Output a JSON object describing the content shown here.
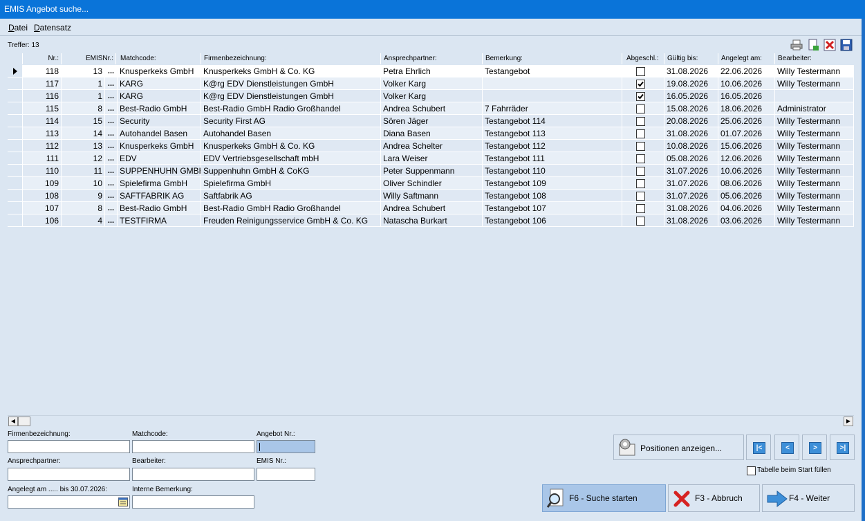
{
  "window": {
    "title": "EMIS Angebot suche..."
  },
  "menu": {
    "items": [
      "Datei",
      "Datensatz"
    ]
  },
  "hits_label": "Treffer: 13",
  "toolbar_icons": [
    "printer-icon",
    "export-icon",
    "delete-icon",
    "save-icon"
  ],
  "columns": {
    "nr": "Nr.:",
    "emisnr": "EMISNr.:",
    "matchcode": "Matchcode:",
    "firma": "Firmenbezeichnung:",
    "ansprech": "Ansprechpartner:",
    "bemerkung": "Bemerkung:",
    "abgeschl": "Abgeschl.:",
    "gueltig": "Gültig bis:",
    "angelegt": "Angelegt am:",
    "bearbeiter": "Bearbeiter:"
  },
  "rows": [
    {
      "nr": "118",
      "emis": "13",
      "dots": "...",
      "match": "Knusperkeks GmbH",
      "firma": "Knusperkeks GmbH & Co. KG",
      "ansprech": "Petra Ehrlich",
      "bem": "Testangebot",
      "checked": false,
      "gueltig": "31.08.2026",
      "angelegt": "22.06.2026",
      "bearb": "Willy Testermann"
    },
    {
      "nr": "117",
      "emis": "1",
      "dots": "...",
      "match": "KARG",
      "firma": "K@rg EDV Dienstleistungen GmbH",
      "ansprech": "Volker Karg",
      "bem": "",
      "checked": true,
      "gueltig": "19.08.2026",
      "angelegt": "10.06.2026",
      "bearb": "Willy Testermann"
    },
    {
      "nr": "116",
      "emis": "1",
      "dots": "...",
      "match": "KARG",
      "firma": "K@rg EDV Dienstleistungen GmbH",
      "ansprech": "Volker Karg",
      "bem": "",
      "checked": true,
      "gueltig": "16.05.2026",
      "angelegt": "16.05.2026",
      "bearb": ""
    },
    {
      "nr": "115",
      "emis": "8",
      "dots": "...",
      "match": "Best-Radio GmbH",
      "firma": "Best-Radio GmbH Radio Großhandel",
      "ansprech": "Andrea Schubert",
      "bem": "7 Fahrräder",
      "checked": false,
      "gueltig": "15.08.2026",
      "angelegt": "18.06.2026",
      "bearb": "Administrator"
    },
    {
      "nr": "114",
      "emis": "15",
      "dots": "...",
      "match": "Security",
      "firma": "Security First AG",
      "ansprech": "Sören Jäger",
      "bem": "Testangebot 114",
      "checked": false,
      "gueltig": "20.08.2026",
      "angelegt": "25.06.2026",
      "bearb": "Willy Testermann"
    },
    {
      "nr": "113",
      "emis": "14",
      "dots": "...",
      "match": "Autohandel Basen",
      "firma": "Autohandel Basen",
      "ansprech": "Diana Basen",
      "bem": "Testangebot 113",
      "checked": false,
      "gueltig": "31.08.2026",
      "angelegt": "01.07.2026",
      "bearb": "Willy Testermann"
    },
    {
      "nr": "112",
      "emis": "13",
      "dots": "...",
      "match": "Knusperkeks GmbH",
      "firma": "Knusperkeks GmbH & Co. KG",
      "ansprech": "Andrea Schelter",
      "bem": "Testangebot 112",
      "checked": false,
      "gueltig": "10.08.2026",
      "angelegt": "15.06.2026",
      "bearb": "Willy Testermann"
    },
    {
      "nr": "111",
      "emis": "12",
      "dots": "...",
      "match": "EDV",
      "firma": "EDV Vertriebsgesellschaft mbH",
      "ansprech": "Lara Weiser",
      "bem": "Testangebot 111",
      "checked": false,
      "gueltig": "05.08.2026",
      "angelegt": "12.06.2026",
      "bearb": "Willy Testermann"
    },
    {
      "nr": "110",
      "emis": "11",
      "dots": "...",
      "match": "SUPPENHUHN GMBH",
      "firma": "Suppenhuhn GmbH & CoKG",
      "ansprech": "Peter Suppenmann",
      "bem": "Testangebot 110",
      "checked": false,
      "gueltig": "31.07.2026",
      "angelegt": "10.06.2026",
      "bearb": "Willy Testermann"
    },
    {
      "nr": "109",
      "emis": "10",
      "dots": "...",
      "match": "Spielefirma GmbH",
      "firma": "Spielefirma GmbH",
      "ansprech": "Oliver Schindler",
      "bem": "Testangebot 109",
      "checked": false,
      "gueltig": "31.07.2026",
      "angelegt": "08.06.2026",
      "bearb": "Willy Testermann"
    },
    {
      "nr": "108",
      "emis": "9",
      "dots": "...",
      "match": "SAFTFABRIK AG",
      "firma": "Saftfabrik AG",
      "ansprech": "Willy Saftmann",
      "bem": "Testangebot 108",
      "checked": false,
      "gueltig": "31.07.2026",
      "angelegt": "05.06.2026",
      "bearb": "Willy Testermann"
    },
    {
      "nr": "107",
      "emis": "8",
      "dots": "...",
      "match": "Best-Radio GmbH",
      "firma": "Best-Radio GmbH Radio Großhandel",
      "ansprech": "Andrea Schubert",
      "bem": "Testangebot 107",
      "checked": false,
      "gueltig": "31.08.2026",
      "angelegt": "04.06.2026",
      "bearb": "Willy Testermann"
    },
    {
      "nr": "106",
      "emis": "4",
      "dots": "...",
      "match": "TESTFIRMA",
      "firma": "Freuden Reinigungsservice GmbH & Co. KG",
      "ansprech": "Natascha Burkart",
      "bem": "Testangebot 106",
      "checked": false,
      "gueltig": "31.08.2026",
      "angelegt": "03.06.2026",
      "bearb": "Willy Testermann"
    }
  ],
  "filters": {
    "firma_label": "Firmenbezeichnung:",
    "match_label": "Matchcode:",
    "angebot_label": "Angebot Nr.:",
    "ansprech_label": "Ansprechpartner:",
    "bearb_label": "Bearbeiter:",
    "emis_label": "EMIS Nr.:",
    "angelegt_label": "Angelegt am ..... bis 30.07.2026:",
    "bemerkung_label": "Interne Bemerkung:"
  },
  "buttons": {
    "positionen": "Positionen anzeigen...",
    "tabelle_fuellen": "Tabelle beim Start füllen",
    "suche": "F6 - Suche starten",
    "abbruch": "F3 - Abbruch",
    "weiter": "F4 - Weiter"
  },
  "colors": {
    "titlebar": "#0a74d9",
    "window_bg": "#dbe6f2",
    "selected_button": "#a9c6e8"
  }
}
